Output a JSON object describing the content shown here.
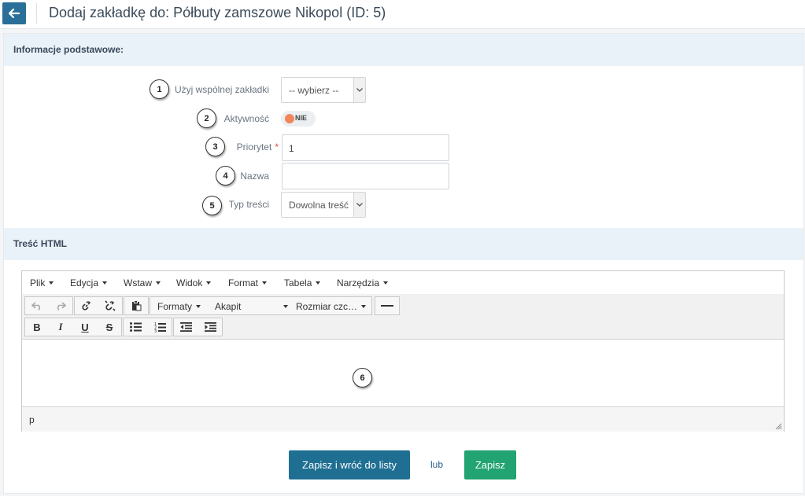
{
  "header": {
    "title": "Dodaj zakładkę do: Półbuty zamszowe Nikopol (ID: 5)"
  },
  "sections": {
    "basic_info": "Informacje podstawowe:",
    "html_content": "Treść HTML"
  },
  "form": {
    "shared_tab_label": "Użyj wspólnej zakładki",
    "shared_tab_value": "-- wybierz --",
    "active_label": "Aktywność",
    "active_toggle": "NIE",
    "priority_label": "Priorytet",
    "priority_required": "*",
    "priority_value": "1",
    "name_label": "Nazwa",
    "name_value": "",
    "content_type_label": "Typ treści",
    "content_type_value": "Dowolna treść"
  },
  "badges": [
    "1",
    "2",
    "3",
    "4",
    "5",
    "6"
  ],
  "editor": {
    "menu": [
      "Plik",
      "Edycja",
      "Wstaw",
      "Widok",
      "Format",
      "Tabela",
      "Narzędzia"
    ],
    "formats_label": "Formaty",
    "block_label": "Akapit",
    "font_size_label": "Rozmiar czc…",
    "bold": "B",
    "italic": "I",
    "underline": "U",
    "strike": "S",
    "status_path": "p"
  },
  "actions": {
    "save_and_back": "Zapisz i wróć do listy",
    "or": "lub",
    "save": "Zapisz"
  },
  "colors": {
    "primary": "#1f6f93",
    "success": "#21a372",
    "section_bg": "#eaf2f9",
    "required": "#e74c3c",
    "toggle_off": "#f0865a"
  }
}
